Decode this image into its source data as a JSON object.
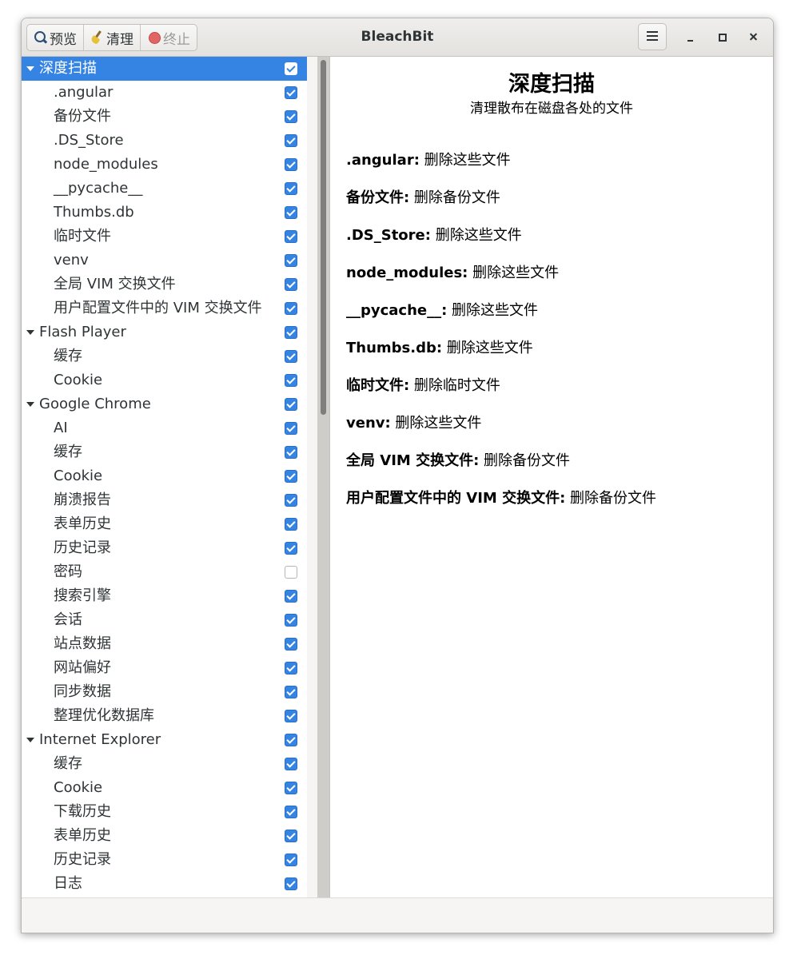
{
  "window": {
    "title": "BleachBit"
  },
  "toolbar": {
    "preview_label": "预览",
    "clean_label": "清理",
    "abort_label": "终止"
  },
  "tree": [
    {
      "type": "parent",
      "label": "深度扫描",
      "checked": true,
      "selected": true
    },
    {
      "type": "child",
      "label": ".angular",
      "checked": true
    },
    {
      "type": "child",
      "label": "备份文件",
      "checked": true
    },
    {
      "type": "child",
      "label": ".DS_Store",
      "checked": true
    },
    {
      "type": "child",
      "label": "node_modules",
      "checked": true
    },
    {
      "type": "child",
      "label": "__pycache__",
      "checked": true
    },
    {
      "type": "child",
      "label": "Thumbs.db",
      "checked": true
    },
    {
      "type": "child",
      "label": "临时文件",
      "checked": true
    },
    {
      "type": "child",
      "label": "venv",
      "checked": true
    },
    {
      "type": "child",
      "label": "全局 VIM 交换文件",
      "checked": true
    },
    {
      "type": "child",
      "label": "用户配置文件中的 VIM 交换文件",
      "checked": true
    },
    {
      "type": "parent",
      "label": "Flash Player",
      "checked": true
    },
    {
      "type": "child",
      "label": "缓存",
      "checked": true
    },
    {
      "type": "child",
      "label": "Cookie",
      "checked": true
    },
    {
      "type": "parent",
      "label": "Google Chrome",
      "checked": true
    },
    {
      "type": "child",
      "label": "AI",
      "checked": true
    },
    {
      "type": "child",
      "label": "缓存",
      "checked": true
    },
    {
      "type": "child",
      "label": "Cookie",
      "checked": true
    },
    {
      "type": "child",
      "label": "崩溃报告",
      "checked": true
    },
    {
      "type": "child",
      "label": "表单历史",
      "checked": true
    },
    {
      "type": "child",
      "label": "历史记录",
      "checked": true
    },
    {
      "type": "child",
      "label": "密码",
      "checked": false
    },
    {
      "type": "child",
      "label": "搜索引擎",
      "checked": true
    },
    {
      "type": "child",
      "label": "会话",
      "checked": true
    },
    {
      "type": "child",
      "label": "站点数据",
      "checked": true
    },
    {
      "type": "child",
      "label": "网站偏好",
      "checked": true
    },
    {
      "type": "child",
      "label": "同步数据",
      "checked": true
    },
    {
      "type": "child",
      "label": "整理优化数据库",
      "checked": true
    },
    {
      "type": "parent",
      "label": "Internet Explorer",
      "checked": true
    },
    {
      "type": "child",
      "label": "缓存",
      "checked": true
    },
    {
      "type": "child",
      "label": "Cookie",
      "checked": true
    },
    {
      "type": "child",
      "label": "下载历史",
      "checked": true
    },
    {
      "type": "child",
      "label": "表单历史",
      "checked": true
    },
    {
      "type": "child",
      "label": "历史记录",
      "checked": true
    },
    {
      "type": "child",
      "label": "日志",
      "checked": true
    }
  ],
  "detail": {
    "title": "深度扫描",
    "subtitle": "清理散布在磁盘各处的文件",
    "items": [
      {
        "name": ".angular:",
        "desc": " 删除这些文件"
      },
      {
        "name": "备份文件:",
        "desc": " 删除备份文件"
      },
      {
        "name": ".DS_Store:",
        "desc": " 删除这些文件"
      },
      {
        "name": "node_modules:",
        "desc": " 删除这些文件"
      },
      {
        "name": "__pycache__:",
        "desc": " 删除这些文件"
      },
      {
        "name": "Thumbs.db:",
        "desc": " 删除这些文件"
      },
      {
        "name": "临时文件:",
        "desc": " 删除临时文件"
      },
      {
        "name": "venv:",
        "desc": " 删除这些文件"
      },
      {
        "name": "全局 VIM 交换文件:",
        "desc": " 删除备份文件"
      },
      {
        "name": "用户配置文件中的 VIM 交换文件:",
        "desc": " 删除备份文件"
      }
    ]
  },
  "colors": {
    "accent": "#3584e4"
  }
}
